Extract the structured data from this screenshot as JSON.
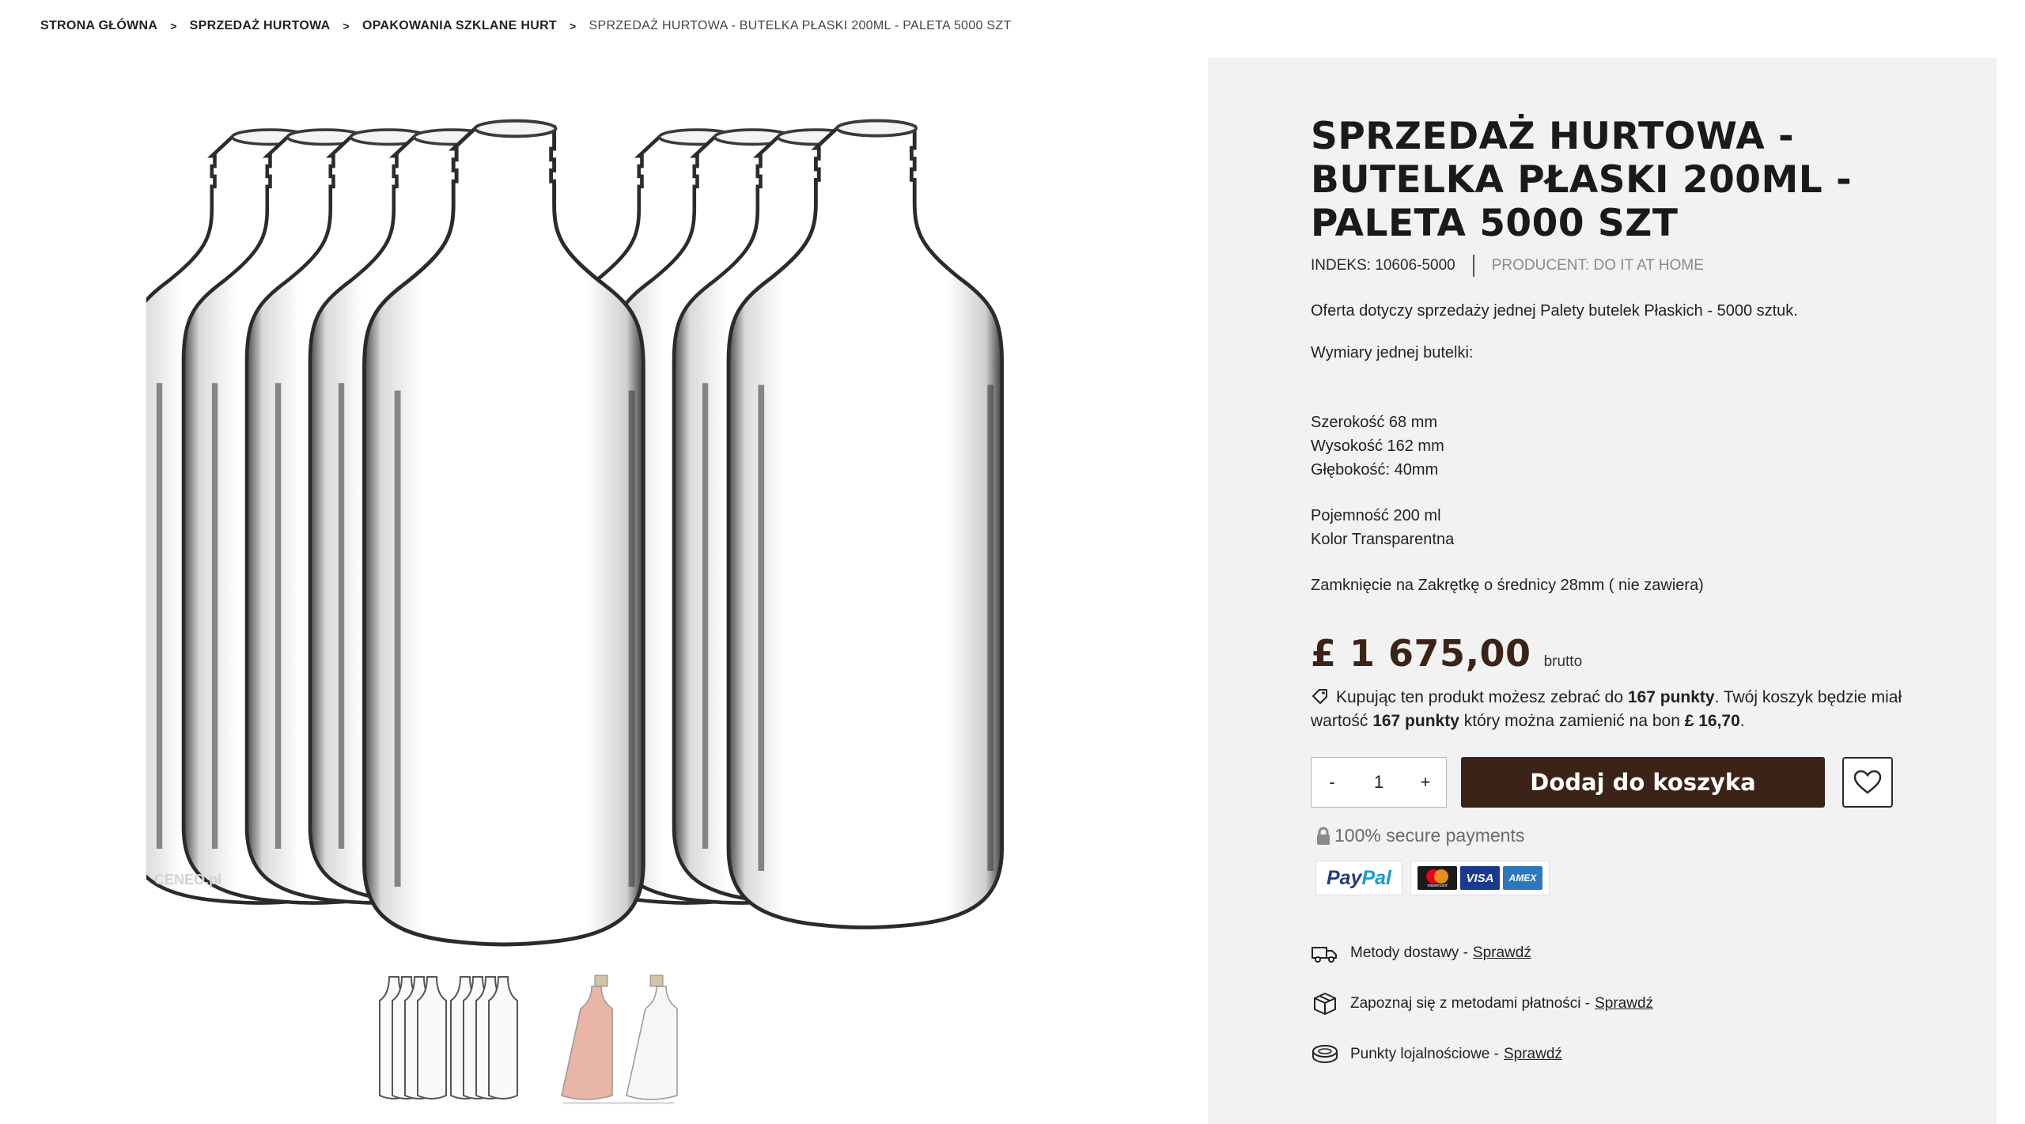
{
  "breadcrumb": {
    "items": [
      "STRONA GŁÓWNA",
      "SPRZEDAŻ HURTOWA",
      "OPAKOWANIA SZKLANE HURT"
    ],
    "separator": ">",
    "current": "SPRZEDAŻ HURTOWA - BUTELKA PŁASKI 200ML - PALETA 5000 SZT"
  },
  "product": {
    "title": "SPRZEDAŻ HURTOWA - BUTELKA PŁASKI 200ML - PALETA 5000 SZT",
    "index": "INDEKS: 10606-5000",
    "producer": "PRODUCENT: DO IT AT HOME",
    "description": {
      "offer": "Oferta dotyczy sprzedaży jednej Palety butelek Płaskich  -  5000 sztuk.",
      "dims_heading": "Wymiary jednej butelki:",
      "width": "Szerokość 68  mm",
      "height": "Wysokość 162 mm",
      "depth": "Głębokość: 40mm",
      "capacity": "Pojemność 200 ml",
      "color": "Kolor Transparentna",
      "closure": "Zamknięcie na Zakrętkę o średnicy 28mm ( nie zawiera)"
    },
    "price": "£ 1 675,00",
    "price_suffix": "brutto",
    "points": {
      "part1": "Kupując ten produkt możesz zebrać do ",
      "points_value": "167 punkty",
      "part2": ". Twój koszyk będzie miał wartość ",
      "cart_points": "167 punkty",
      "part3": " który można zamienić na bon ",
      "voucher": "£ 16,70",
      "part4": "."
    }
  },
  "cart": {
    "minus": "-",
    "quantity": "1",
    "plus": "+",
    "add_label": "Dodaj do koszyka"
  },
  "secure": {
    "text": "100% secure payments"
  },
  "payment_logos": {
    "paypal_a": "Pay",
    "paypal_b": "Pal",
    "mastercard": "mastercard",
    "visa": "VISA",
    "amex": "AMEX"
  },
  "info_links": [
    {
      "label": "Metody dostawy -",
      "link": "Sprawdź",
      "icon": "truck-icon"
    },
    {
      "label": "Zapoznaj się z metodami płatności -",
      "link": "Sprawdź",
      "icon": "box-icon"
    },
    {
      "label": "Punkty lojalnościowe -",
      "link": "Sprawdź",
      "icon": "coin-icon"
    }
  ],
  "colors": {
    "brand_brown": "#3b2417",
    "panel_bg": "#f2f2f2"
  },
  "watermark": "CENEO.pl"
}
